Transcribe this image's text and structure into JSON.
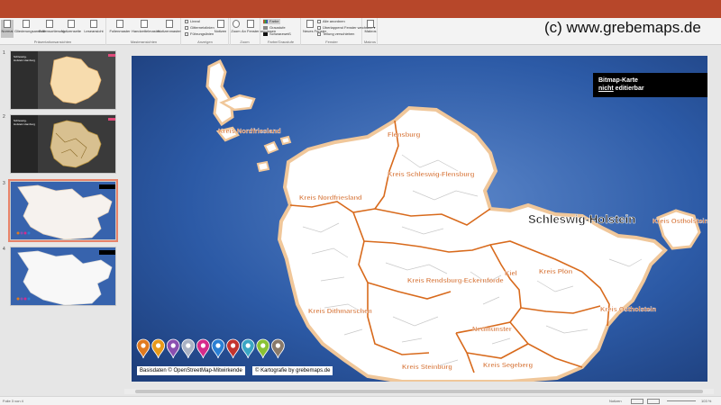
{
  "window": {
    "accent": "#b7472a"
  },
  "watermark": "(c) www.grebemaps.de",
  "ribbon": {
    "views": [
      "Normal",
      "Gliederungsansicht",
      "Foliensortierung",
      "Notizenseite",
      "Leseansicht"
    ],
    "views_caption": "Präsentationsansichten",
    "masters": [
      "Folienmaster",
      "Handzettelmaster",
      "Notizenmaster"
    ],
    "masters_caption": "Masteransichten",
    "show": [
      "Lineal",
      "Gitternetzlinien",
      "Führungslinien"
    ],
    "show_caption": "Anzeigen",
    "notes": "Notizen",
    "zoom": [
      "Zoom",
      "An Fenster anpassen"
    ],
    "zoom_caption": "Zoom",
    "color": [
      "Farbe",
      "Graustufe",
      "Schwarzweiß"
    ],
    "color_caption": "Farbe/Graustufe",
    "window": [
      "Neues Fenster",
      "Alle anordnen",
      "Überlappend",
      "Teilung verschieben",
      "Fenster wechseln"
    ],
    "window_caption": "Fenster",
    "macros": "Makros",
    "macros_caption": "Makros"
  },
  "thumbnails": [
    {
      "number": "1",
      "title": "Schleswig-Holstein Hamburg"
    },
    {
      "number": "2",
      "title": "Schleswig-Holstein Hamburg"
    },
    {
      "number": "3",
      "title": ""
    },
    {
      "number": "4",
      "title": ""
    }
  ],
  "map": {
    "state_label": "Schleswig-Holstein",
    "bitmap_line1": "Bitmap-Karte",
    "bitmap_line2_emph": "nicht",
    "bitmap_line2_rest": " editierbar",
    "districts": [
      "Kreis Nordfriesland",
      "Flensburg",
      "Kreis Nordfriesland",
      "Kreis Schleswig-Flensburg",
      "Kreis Ostholstein",
      "Kiel",
      "Kreis Plön",
      "Kreis Rendsburg-Eckernförde",
      "Kreis Dithmarschen",
      "Neumünster",
      "Kreis Ostholstein",
      "Kreis Steinburg",
      "Kreis Segeberg"
    ],
    "pin_colors": [
      "#e07a1f",
      "#e89a1a",
      "#8a4fb0",
      "#aab2c4",
      "#d62b8b",
      "#2a7fd4",
      "#c3342e",
      "#3aa6c4",
      "#8ac234",
      "#8a7a6a"
    ],
    "credit_osm": "Basisdaten © OpenStreetMap-Mitwirkende",
    "credit_carto": "© Kartografie by grebemaps.de",
    "district_label_color": "#cf5a12",
    "ocean_color": "#2c5aa6"
  },
  "status": {
    "slide_info": "Folie 3 von 4",
    "notes": "Notizen",
    "zoom": "103 %"
  }
}
